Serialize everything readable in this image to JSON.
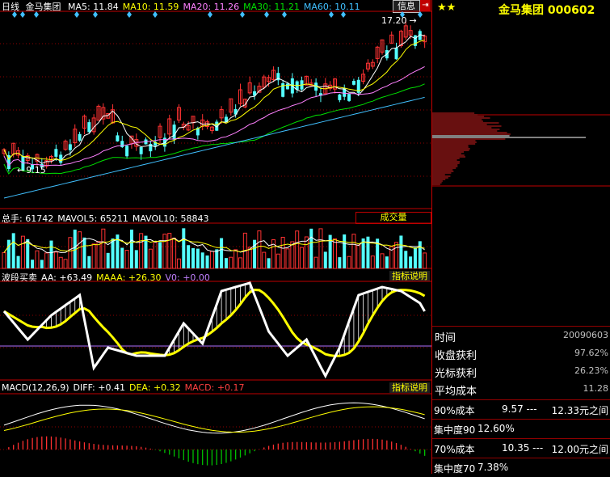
{
  "header": {
    "period": "日线",
    "name": "金马集团",
    "ma": [
      {
        "label": "MA5: 11.84",
        "color": "#ffffff"
      },
      {
        "label": "MA10: 11.59",
        "color": "#ffff00"
      },
      {
        "label": "MA20: 11.26",
        "color": "#ff80ff"
      },
      {
        "label": "MA30: 11.21",
        "color": "#00e000"
      },
      {
        "label": "MA60: 10.11",
        "color": "#40c0ff"
      }
    ],
    "info_button": "信息",
    "close_icon": "exit-icon"
  },
  "price_panel": {
    "high_marker": "17.20",
    "low_marker": "9.15"
  },
  "volume_panel": {
    "stats": [
      {
        "label": "总手: 61742",
        "color": "#ffffff"
      },
      {
        "label": "MAVOL5: 65211",
        "color": "#ffffff"
      },
      {
        "label": "MAVOL10: 58843",
        "color": "#ffffff"
      }
    ],
    "selector": "成交量"
  },
  "wave_panel": {
    "stats": [
      {
        "label": "波段买卖",
        "color": "#ffffff"
      },
      {
        "label": "AA: +63.49",
        "color": "#ffffff"
      },
      {
        "label": "MAAA: +26.30",
        "color": "#ffff00"
      },
      {
        "label": "V0: +0.00",
        "color": "#c080ff"
      }
    ],
    "help_button": "指标说明"
  },
  "macd_panel": {
    "stats": [
      {
        "label": "MACD(12,26,9)",
        "color": "#ffffff"
      },
      {
        "label": "DIFF: +0.41",
        "color": "#ffffff"
      },
      {
        "label": "DEA: +0.32",
        "color": "#ffff00"
      },
      {
        "label": "MACD: +0.17",
        "color": "#ff4040"
      }
    ],
    "help_button": "指标说明"
  },
  "side": {
    "stars": "★★",
    "title": "金马集团 000602",
    "rows": [
      {
        "label": "时间",
        "value": "20090603"
      },
      {
        "label": "收盘获利",
        "value": "97.62%"
      },
      {
        "label": "光标获利",
        "value": "26.23%"
      },
      {
        "label": "平均成本",
        "value": "11.28"
      }
    ],
    "bottom": [
      {
        "a": "90%成本",
        "b": "9.57 ---",
        "c": "12.33元之间"
      },
      {
        "a": "集中度90",
        "b": "12.60%",
        "c": ""
      },
      {
        "a": "70%成本",
        "b": "10.35 ---",
        "c": "12.00元之间"
      },
      {
        "a": "集中度70",
        "b": "7.38%",
        "c": ""
      }
    ]
  },
  "colors": {
    "up": "#ff3232",
    "down": "#54ffff",
    "grid": "#900000",
    "chip_red": "#d02020",
    "chip_current": "#ffffff"
  }
}
